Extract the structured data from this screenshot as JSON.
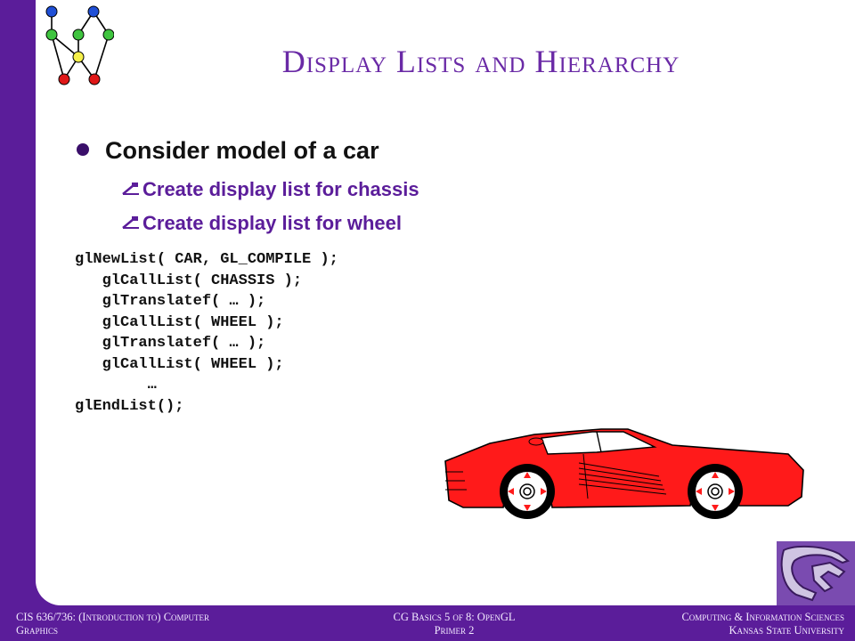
{
  "slide": {
    "title": "Display Lists and Hierarchy",
    "bullet": "Consider model of a car",
    "sub_items": [
      "Create display list for chassis",
      "Create display list for wheel"
    ],
    "code": [
      "glNewList( CAR, GL_COMPILE );",
      "   glCallList( CHASSIS );",
      "   glTranslatef( … );",
      "   glCallList( WHEEL );",
      "   glTranslatef( … );",
      "   glCallList( WHEEL );",
      "        …",
      "glEndList();"
    ]
  },
  "footer": {
    "left_line1": "CIS 636/736:  (Introduction to) Computer",
    "left_line2": "Graphics",
    "center_line1": "CG Basics 5 of 8: OpenGL",
    "center_line2": "Primer 2",
    "right_line1": "Computing & Information Sciences",
    "right_line2": "Kansas State University"
  },
  "images": {
    "tree_logo": "graph-tree-icon",
    "car": "red-sports-car-illustration",
    "university_logo": "wildcat-logo"
  },
  "colors": {
    "frame": "#5b1d9a",
    "title": "#6a2aa6",
    "car_body": "#ff1a1a"
  }
}
